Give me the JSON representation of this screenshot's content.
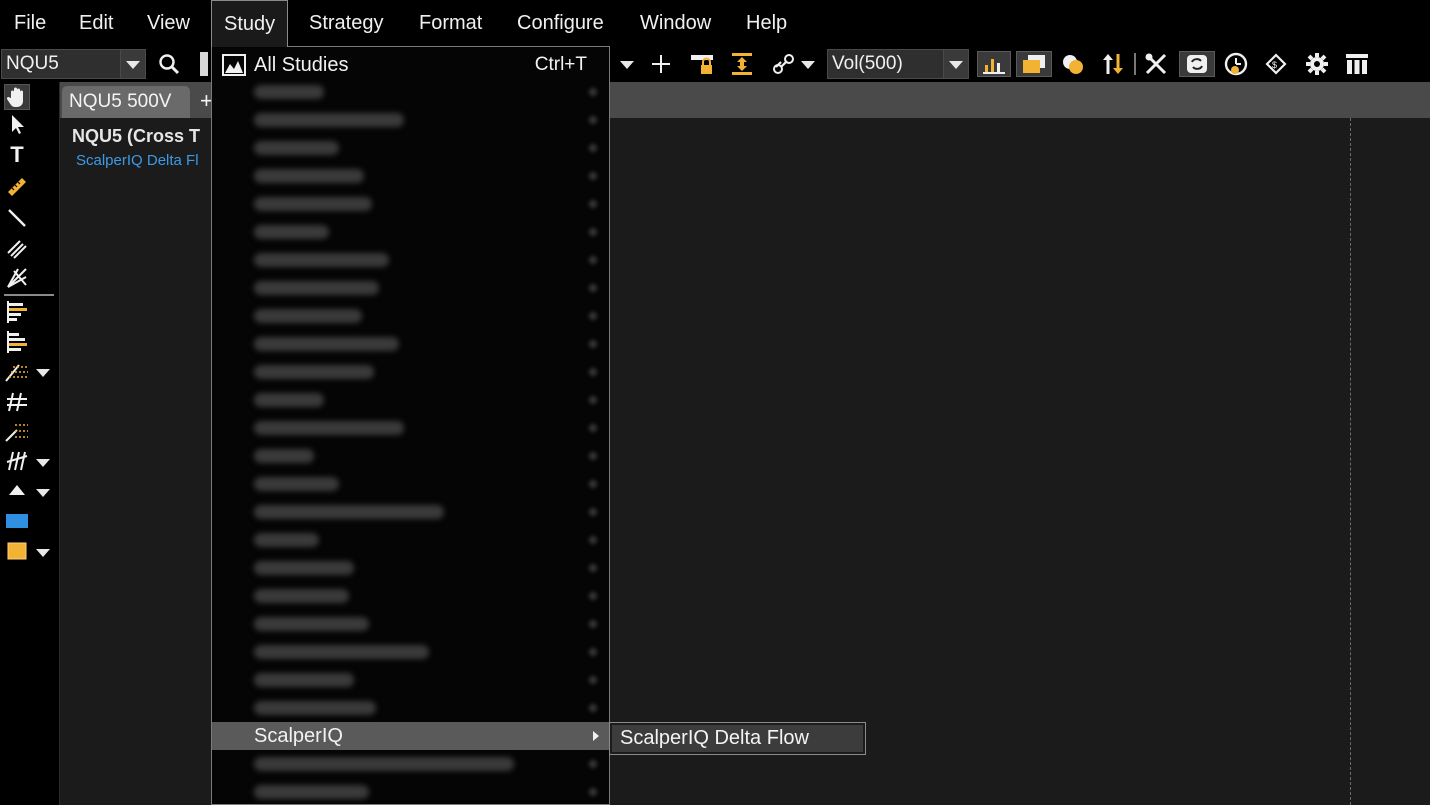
{
  "menubar": {
    "items": [
      "File",
      "Edit",
      "View",
      "Study",
      "Strategy",
      "Format",
      "Configure",
      "Window",
      "Help"
    ],
    "active": "Study"
  },
  "toolbar": {
    "symbol": "NQU5",
    "bar_type": "Vol(500)"
  },
  "chart": {
    "tab_label": "NQU5 500V",
    "tab_add": "+",
    "title": "NQU5 (Cross T",
    "study_label": "ScalperIQ Delta Fl"
  },
  "study_menu": {
    "all_studies": {
      "label": "All Studies",
      "shortcut": "Ctrl+T"
    },
    "highlighted": {
      "label": "ScalperIQ"
    },
    "submenu": {
      "item": "ScalperIQ Delta Flow"
    }
  },
  "colors": {
    "accent_orange": "#f2b233",
    "study_blue": "#3d9ae8",
    "rect_blue": "#2f8fe0"
  }
}
